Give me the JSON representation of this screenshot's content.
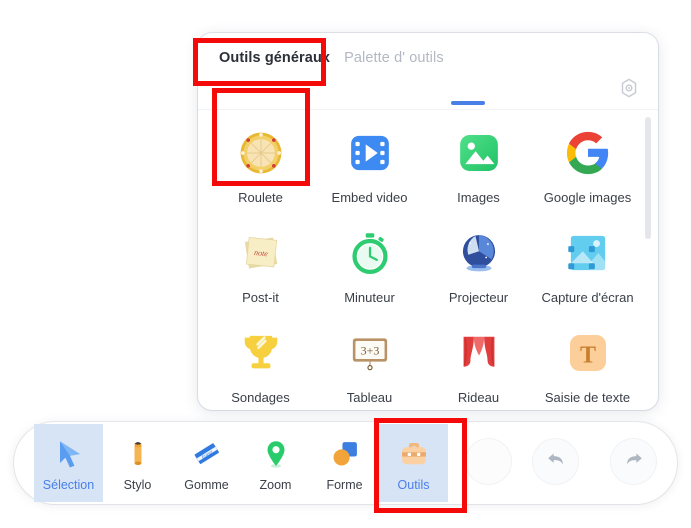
{
  "panel": {
    "tabs": [
      {
        "label": "Outils généraux",
        "active": true,
        "name": "tab-outils-generaux"
      },
      {
        "label": "Palette d'  outils",
        "active": false,
        "name": "tab-palette-outils"
      }
    ],
    "settings_icon": "gear-icon",
    "tools": [
      {
        "label": "Roulete",
        "icon": "roulette-wheel-icon",
        "name": "tool-roulete"
      },
      {
        "label": "Embed video",
        "icon": "video-embed-icon",
        "name": "tool-embed-video"
      },
      {
        "label": "Images",
        "icon": "image-icon",
        "name": "tool-images"
      },
      {
        "label": "Google images",
        "icon": "google-logo-icon",
        "name": "tool-google-images"
      },
      {
        "label": "Post-it",
        "icon": "sticky-note-icon",
        "name": "tool-post-it"
      },
      {
        "label": "Minuteur",
        "icon": "stopwatch-icon",
        "name": "tool-minuteur"
      },
      {
        "label": "Projecteur",
        "icon": "spotlight-icon",
        "name": "tool-projecteur"
      },
      {
        "label": "Capture d'écran",
        "icon": "screenshot-icon",
        "name": "tool-capture-ecran"
      },
      {
        "label": "Sondages",
        "icon": "trophy-icon",
        "name": "tool-sondages"
      },
      {
        "label": "Tableau",
        "icon": "whiteboard-3plus3-icon",
        "name": "tool-tableau"
      },
      {
        "label": "Rideau",
        "icon": "curtain-icon",
        "name": "tool-rideau"
      },
      {
        "label": "Saisie de texte",
        "icon": "text-input-t-icon",
        "name": "tool-saisie-de-texte"
      }
    ]
  },
  "toolbar": {
    "items": [
      {
        "label": "Sélection",
        "icon": "cursor-arrow-icon",
        "selected": true,
        "name": "toolbar-item-selection"
      },
      {
        "label": "Stylo",
        "icon": "pencil-icon",
        "selected": false,
        "name": "toolbar-item-stylo"
      },
      {
        "label": "Gomme",
        "icon": "eraser-icon",
        "selected": false,
        "name": "toolbar-item-gomme"
      },
      {
        "label": "Zoom",
        "icon": "map-pin-icon",
        "selected": false,
        "name": "toolbar-item-zoom"
      },
      {
        "label": "Forme",
        "icon": "shapes-icon",
        "selected": false,
        "name": "toolbar-item-forme"
      },
      {
        "label": "Outils",
        "icon": "toolbox-icon",
        "selected": true,
        "name": "toolbar-item-outils"
      }
    ],
    "undo_icon": "undo-arrow-icon",
    "redo_icon": "redo-arrow-icon"
  },
  "annotations": {
    "color": "#f50a0a",
    "boxes": [
      {
        "target": "tab-outils-generaux"
      },
      {
        "target": "tool-roulete"
      },
      {
        "target": "toolbar-item-outils"
      }
    ]
  }
}
